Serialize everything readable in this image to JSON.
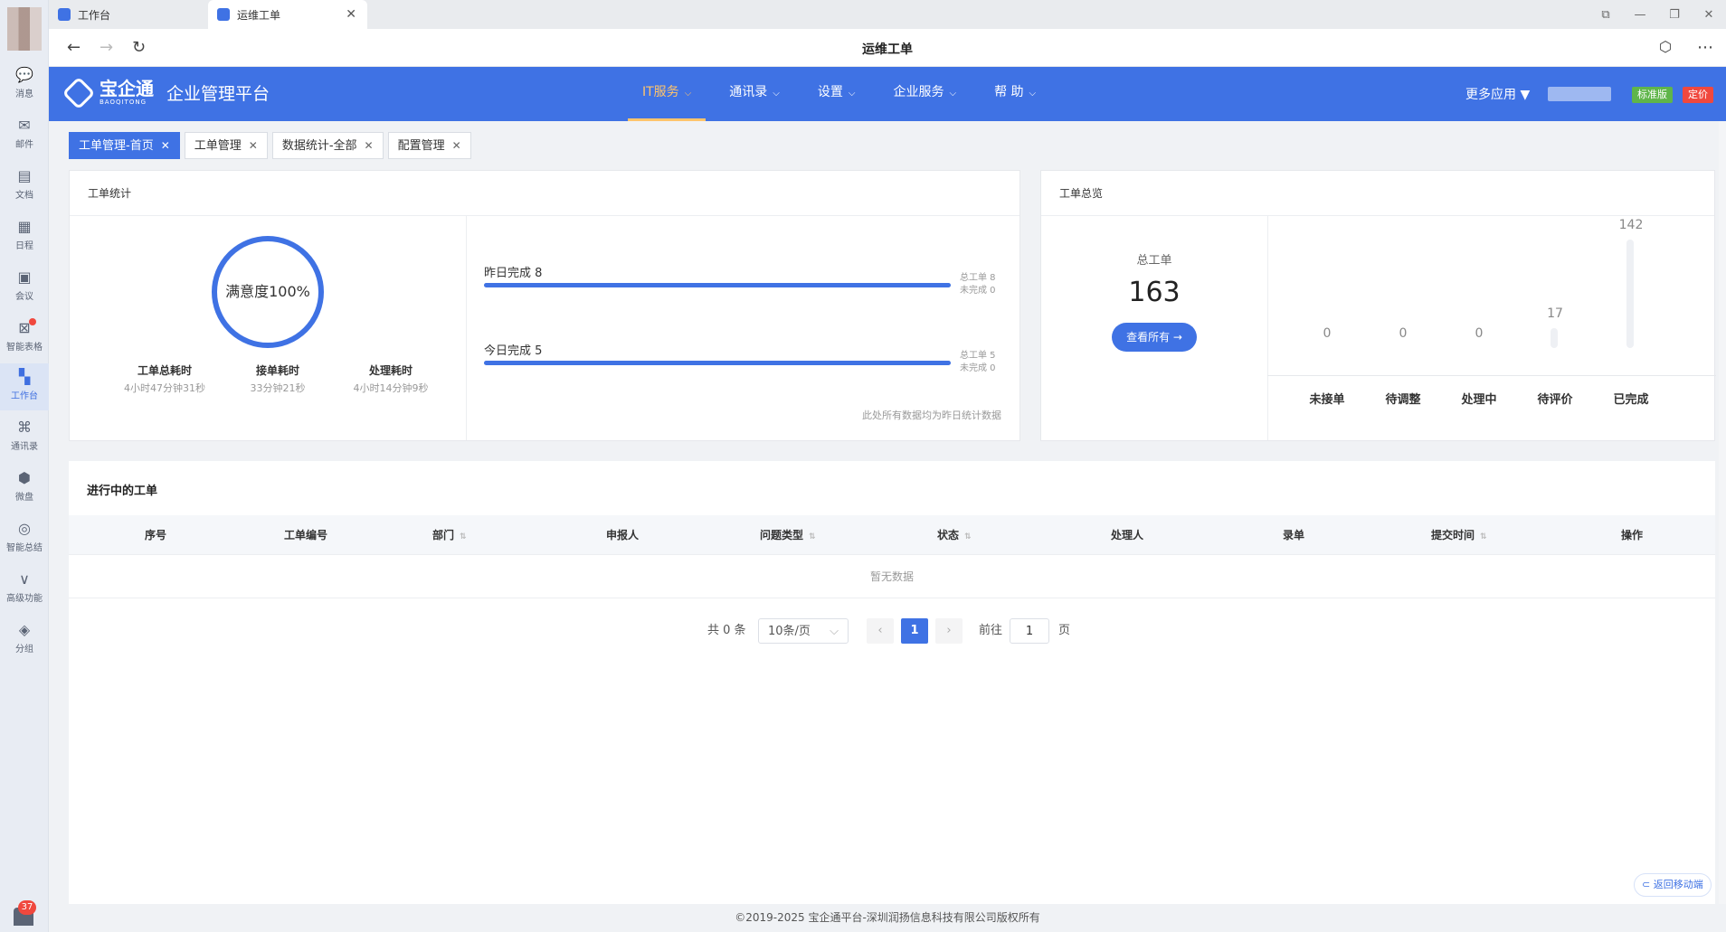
{
  "rail": {
    "items": [
      {
        "label": "消息",
        "icon": "chat-icon"
      },
      {
        "label": "邮件",
        "icon": "mail-icon"
      },
      {
        "label": "文档",
        "icon": "document-icon"
      },
      {
        "label": "日程",
        "icon": "calendar-icon"
      },
      {
        "label": "会议",
        "icon": "meeting-icon"
      },
      {
        "label": "智能表格",
        "icon": "sheet-icon"
      },
      {
        "label": "工作台",
        "icon": "workbench-icon"
      },
      {
        "label": "通讯录",
        "icon": "contacts-icon"
      },
      {
        "label": "微盘",
        "icon": "drive-icon"
      },
      {
        "label": "智能总结",
        "icon": "summary-icon"
      },
      {
        "label": "高级功能",
        "icon": "advanced-icon"
      },
      {
        "label": "分组",
        "icon": "tag-icon"
      }
    ],
    "badge": "37"
  },
  "browser": {
    "tabs": [
      {
        "label": "工作台"
      },
      {
        "label": "运维工单"
      }
    ],
    "title": "运维工单"
  },
  "header": {
    "brand": "宝企通",
    "brand_sub": "BAOQITONG",
    "platform": "企业管理平台",
    "menu": [
      {
        "label": "IT服务"
      },
      {
        "label": "通讯录"
      },
      {
        "label": "设置"
      },
      {
        "label": "企业服务"
      },
      {
        "label": "帮 助"
      }
    ],
    "more_apps": "更多应用",
    "edition": "标准版",
    "pricing": "定价"
  },
  "page_tabs": [
    {
      "label": "工单管理-首页"
    },
    {
      "label": "工单管理"
    },
    {
      "label": "数据统计-全部"
    },
    {
      "label": "配置管理"
    }
  ],
  "stats": {
    "title": "工单统计",
    "satisfaction": "满意度100%",
    "metrics": [
      {
        "label": "工单总耗时",
        "value": "4小时47分钟31秒"
      },
      {
        "label": "接单耗时",
        "value": "33分钟21秒"
      },
      {
        "label": "处理耗时",
        "value": "4小时14分钟9秒"
      }
    ],
    "yesterday": {
      "label": "昨日完成 8",
      "total": "总工单 8",
      "incomplete": "未完成 0",
      "progress": 1.0
    },
    "today": {
      "label": "今日完成 5",
      "total": "总工单 5",
      "incomplete": "未完成 0",
      "progress": 1.0
    },
    "note": "此处所有数据均为昨日统计数据"
  },
  "overview": {
    "title": "工单总览",
    "total_label": "总工单",
    "total_value": "163",
    "view_all": "查看所有 →",
    "chart_data": {
      "type": "bar",
      "categories": [
        "未接单",
        "待调整",
        "处理中",
        "待评价",
        "已完成"
      ],
      "values": [
        0,
        0,
        0,
        17,
        142
      ],
      "ylim": [
        0,
        142
      ]
    }
  },
  "ongoing": {
    "title": "进行中的工单",
    "columns": [
      "序号",
      "工单编号",
      "部门",
      "申报人",
      "问题类型",
      "状态",
      "处理人",
      "录单",
      "提交时间",
      "操作"
    ],
    "empty": "暂无数据",
    "pager": {
      "total": "共 0 条",
      "size": "10条/页",
      "page": "1",
      "goto": "前往",
      "goto_value": "1",
      "unit": "页"
    }
  },
  "back_mobile": "返回移动端",
  "footer": "©2019-2025 宝企通平台-深圳润扬信息科技有限公司版权所有"
}
